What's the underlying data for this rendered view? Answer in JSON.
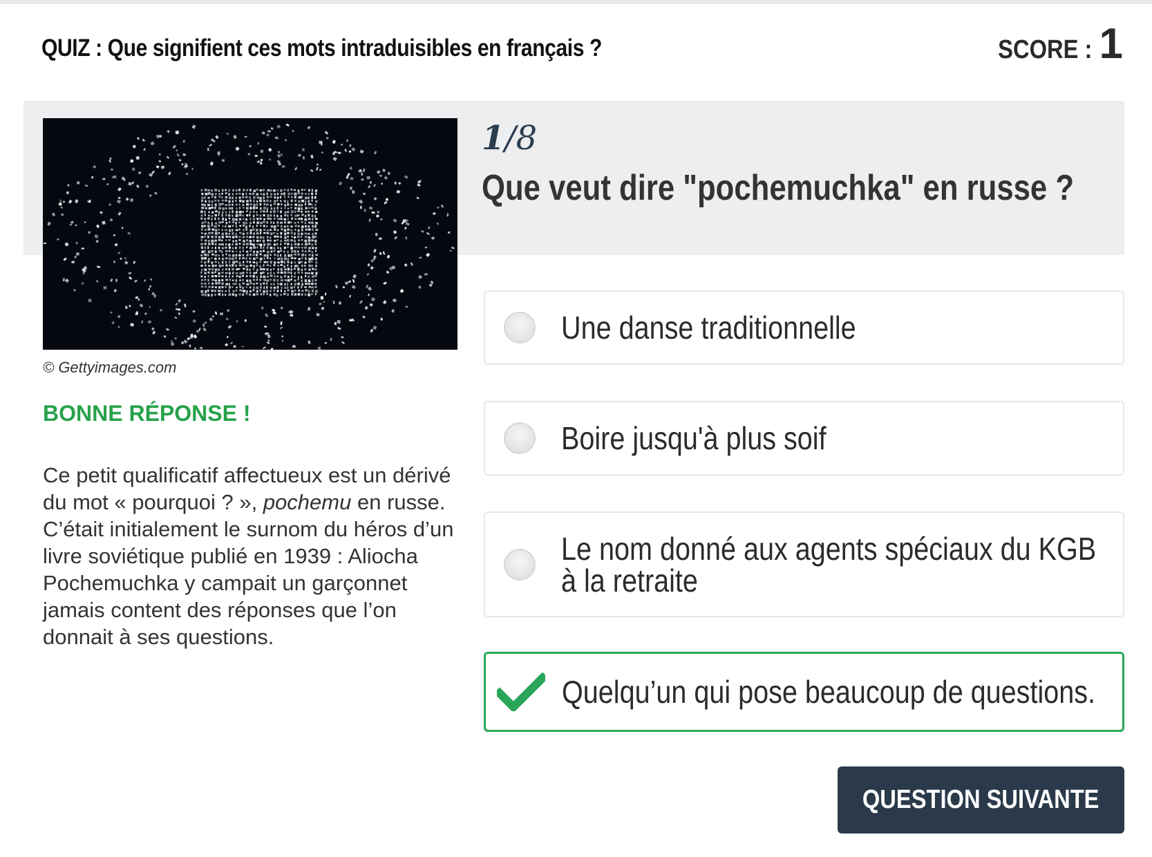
{
  "header": {
    "title": "QUIZ : Que signifient ces mots intraduisibles en français ?",
    "score_label": "SCORE :",
    "score_value": "1"
  },
  "question": {
    "current": "1",
    "total_text": "/8",
    "text": "Que veut dire \"pochemuchka\" en russe ?"
  },
  "image": {
    "credit": "© Gettyimages.com",
    "icon": "photo-letters-icon"
  },
  "feedback": {
    "verdict": "BONNE RÉPONSE !",
    "verdict_color": "#27a24a",
    "explanation_before": "Ce petit qualificatif affectueux est un dérivé du mot « pourquoi ? », ",
    "explanation_italic": "pochemu",
    "explanation_after": " en russe. C’était initialement le surnom du héros d’un livre soviétique publié en 1939 : Aliocha Pochemuchka y campait un garçonnet jamais content des réponses que l’on donnait à ses questions."
  },
  "answers": [
    {
      "label": "Une danse traditionnelle",
      "state": "unselected"
    },
    {
      "label": "Boire jusqu'à plus soif",
      "state": "unselected"
    },
    {
      "label": "Le nom donné aux agents spéciaux du KGB à la retraite",
      "line1": "Le nom donné aux agents spéciaux du KGB",
      "line2": "à la retraite",
      "state": "unselected"
    },
    {
      "label": "Quelqu’un qui pose beaucoup de questions.",
      "state": "correct"
    }
  ],
  "next_button": {
    "label": "QUESTION SUIVANTE",
    "color": "#2b3a4a"
  },
  "colors": {
    "correct": "#2aa65b",
    "band": "#eceeef"
  }
}
